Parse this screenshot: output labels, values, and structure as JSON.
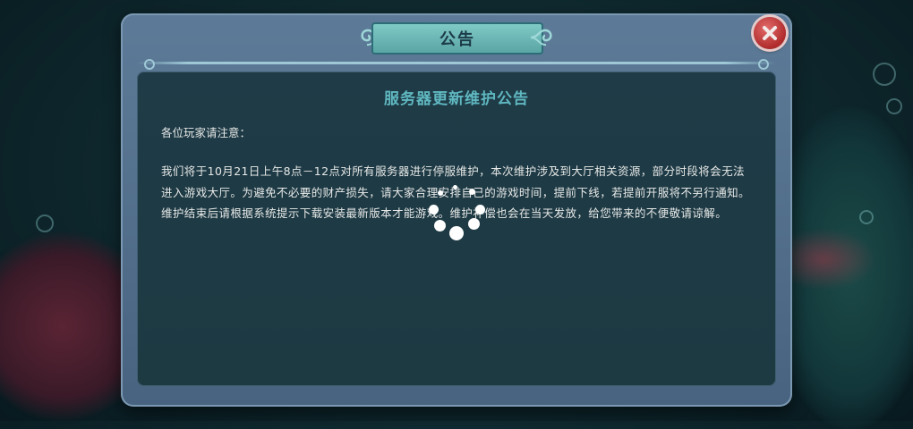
{
  "dialog": {
    "title": "公告",
    "close_icon": "close-x-icon",
    "notice": {
      "heading": "服务器更新维护公告",
      "greeting": "各位玩家请注意：",
      "body": "我们将于10月21日上午8点－12点对所有服务器进行停服维护，本次维护涉及到大厅相关资源，部分时段将会无法进入游戏大厅。为避免不必要的财产损失，请大家合理安排自己的游戏时间，提前下线，若提前开服将不另行通知。维护结束后请根据系统提示下载安装最新版本才能游戏。维护补偿也会在当天发放，给您带来的不便敬请谅解。"
    }
  },
  "loading": {
    "icon": "loading-spinner-icon"
  },
  "colors": {
    "heading_teal": "#5fb7c0",
    "title_plate": "#7fc9c6",
    "close_red": "#c43a3a",
    "panel_bg": "#1f3b47",
    "frame_blue": "#5d7b98"
  }
}
